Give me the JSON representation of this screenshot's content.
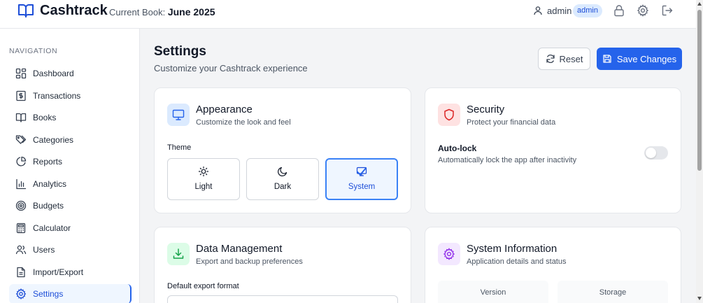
{
  "header": {
    "app_name": "Cashtrack",
    "book_label": "Current Book:",
    "book_value": "June 2025",
    "user_name": "admin",
    "role_badge": "admin"
  },
  "sidebar": {
    "heading": "NAVIGATION",
    "items": [
      {
        "label": "Dashboard",
        "icon": "dashboard-icon"
      },
      {
        "label": "Transactions",
        "icon": "dollar-receipt-icon"
      },
      {
        "label": "Books",
        "icon": "book-icon"
      },
      {
        "label": "Categories",
        "icon": "tags-icon"
      },
      {
        "label": "Reports",
        "icon": "pie-chart-icon"
      },
      {
        "label": "Analytics",
        "icon": "bar-chart-icon"
      },
      {
        "label": "Budgets",
        "icon": "target-icon"
      },
      {
        "label": "Calculator",
        "icon": "calculator-icon"
      },
      {
        "label": "Users",
        "icon": "users-icon"
      },
      {
        "label": "Import/Export",
        "icon": "file-icon"
      },
      {
        "label": "Settings",
        "icon": "gear-icon",
        "active": true
      }
    ]
  },
  "page": {
    "title": "Settings",
    "subtitle": "Customize your Cashtrack experience",
    "reset_label": "Reset",
    "save_label": "Save Changes"
  },
  "appearance": {
    "title": "Appearance",
    "desc": "Customize the look and feel",
    "theme_label": "Theme",
    "options": [
      "Light",
      "Dark",
      "System"
    ],
    "selected": "System"
  },
  "security": {
    "title": "Security",
    "desc": "Protect your financial data",
    "autolock_title": "Auto-lock",
    "autolock_desc": "Automatically lock the app after inactivity",
    "autolock_enabled": false
  },
  "data_management": {
    "title": "Data Management",
    "desc": "Export and backup preferences",
    "export_label": "Default export format"
  },
  "system_info": {
    "title": "System Information",
    "desc": "Application details and status",
    "version_label": "Version",
    "storage_label": "Storage"
  },
  "colors": {
    "accent": "#2563eb",
    "active_bg": "#eff6ff",
    "appearance_icon_bg": "#dbeafe",
    "security_icon_bg": "#fee2e2",
    "data_icon_bg": "#dcfce7",
    "system_icon_bg": "#f3e8ff"
  }
}
